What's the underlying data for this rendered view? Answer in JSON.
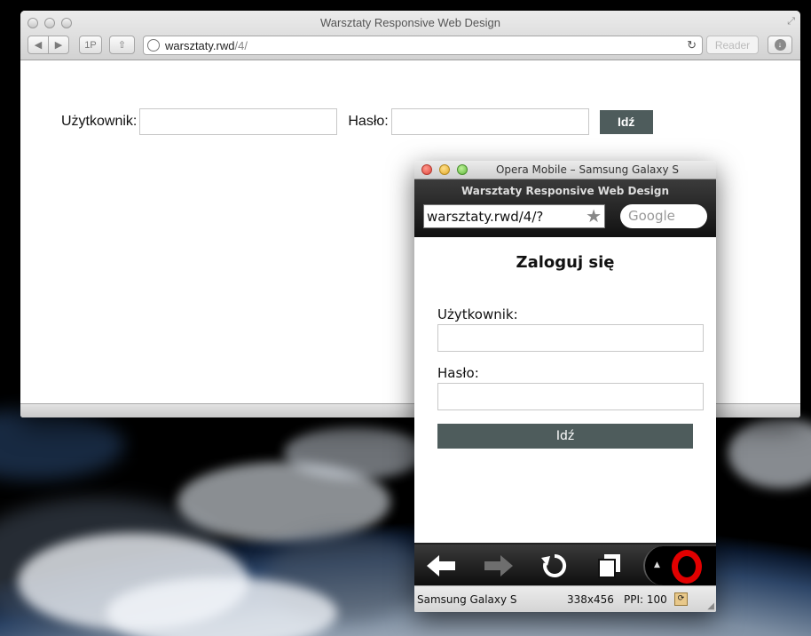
{
  "safari": {
    "window_title": "Warsztaty Responsive Web Design",
    "toolbar": {
      "back_label": "◀",
      "forward_label": "▶",
      "onepassword_label": "1P",
      "share_label": "⇧",
      "reload_label": "↻",
      "reader_label": "Reader",
      "download_label": "↓",
      "fullscreen_label": "⤢"
    },
    "address": {
      "host": "warsztaty.rwd",
      "path": "/4/"
    },
    "form": {
      "user_label": "Użytkownik:",
      "password_label": "Hasło:",
      "user_value": "",
      "password_value": "",
      "submit_label": "Idź"
    }
  },
  "opera": {
    "window_title": "Opera Mobile – Samsung Galaxy S",
    "page_title": "Warsztaty Responsive Web Design",
    "url": "warsztaty.rwd/4/?",
    "search_placeholder": "Google",
    "content": {
      "heading": "Zaloguj się",
      "user_label": "Użytkownik:",
      "password_label": "Hasło:",
      "user_value": "",
      "password_value": "",
      "submit_label": "Idź"
    },
    "toolbar": {
      "back_icon": "arrow-left-icon",
      "forward_icon": "arrow-right-icon",
      "reload_icon": "reload-icon",
      "tabs_icon": "tabs-icon",
      "menu_icon": "opera-logo-icon"
    },
    "status": {
      "device": "Samsung Galaxy S",
      "resolution": "338x456",
      "ppi": "PPI: 100"
    }
  }
}
